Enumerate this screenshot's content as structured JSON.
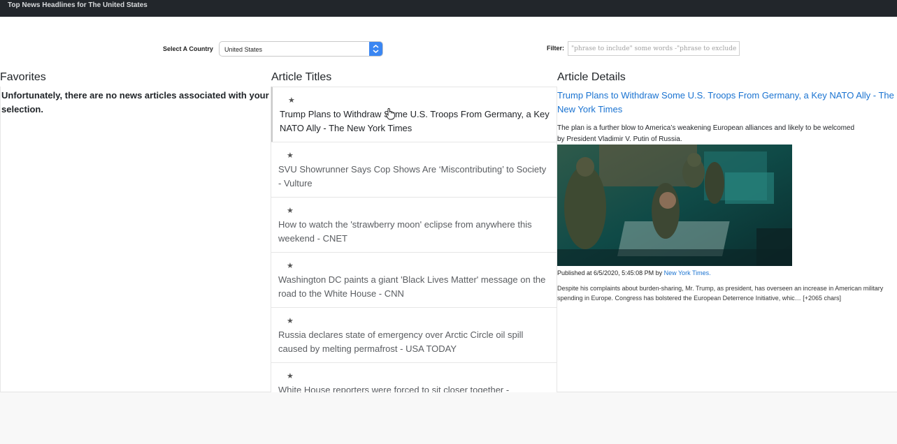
{
  "header": {
    "title": "Top News Headlines for The United States"
  },
  "controls": {
    "country_label": "Select A Country",
    "country_value": "United States",
    "filter_label": "Filter:",
    "filter_placeholder": "\"phrase to include\" some words -\"phrase to exclude\""
  },
  "favorites": {
    "heading": "Favorites",
    "empty_message": "Unfortunately, there are no news articles associated with your selection."
  },
  "titles": {
    "heading": "Article Titles",
    "items": [
      {
        "star": "★",
        "title": "Trump Plans to Withdraw Some U.S. Troops From Germany, a Key NATO Ally - The New York Times"
      },
      {
        "star": "★",
        "title": "SVU Showrunner Says Cop Shows Are ‘Miscontributing’ to Society - Vulture"
      },
      {
        "star": "★",
        "title": "How to watch the 'strawberry moon' eclipse from anywhere this weekend - CNET"
      },
      {
        "star": "★",
        "title": "Washington DC paints a giant 'Black Lives Matter' message on the road to the White House - CNN"
      },
      {
        "star": "★",
        "title": "Russia declares state of emergency over Arctic Circle oil spill caused by melting permafrost - USA TODAY"
      },
      {
        "star": "★",
        "title": "White House reporters were forced to sit closer together -"
      }
    ]
  },
  "details": {
    "heading": "Article Details",
    "title": "Trump Plans to Withdraw Some U.S. Troops From Germany, a Key NATO Ally - The New York Times",
    "description_line1": "The plan is a further blow to America’s weakening European alliances and likely to be welcomed",
    "description_line2": "by President Vladimir V. Putin of Russia.",
    "published_prefix": "Published at 6/5/2020, 5:45:08 PM by",
    "source": "New York Times.",
    "content": "Despite his complaints about burden-sharing, Mr. Trump, as president, has overseen an increase in American military spending in Europe. Congress has bolstered the European Deterrence Initiative, whic… [+2065 chars]"
  },
  "colors": {
    "topbar": "#22262b",
    "link": "#1a73d1",
    "select_accent": "#3a86f2"
  }
}
